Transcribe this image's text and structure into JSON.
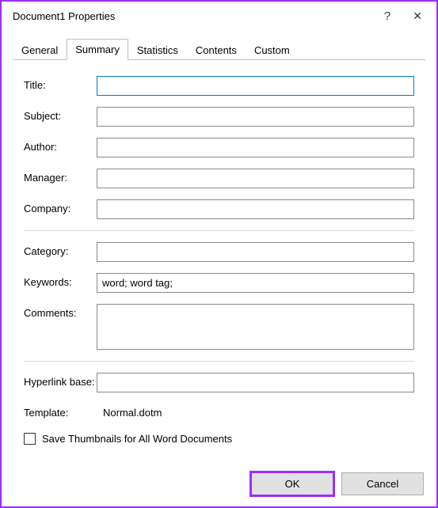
{
  "window": {
    "title": "Document1 Properties"
  },
  "tabs": {
    "general": "General",
    "summary": "Summary",
    "statistics": "Statistics",
    "contents": "Contents",
    "custom": "Custom"
  },
  "labels": {
    "title": "Title:",
    "subject": "Subject:",
    "author": "Author:",
    "manager": "Manager:",
    "company": "Company:",
    "category": "Category:",
    "keywords": "Keywords:",
    "comments": "Comments:",
    "hyperlink_base": "Hyperlink base:",
    "template": "Template:",
    "save_thumbnails": "Save Thumbnails for All Word Documents"
  },
  "values": {
    "title": "",
    "subject": "",
    "author": "",
    "manager": "",
    "company": "",
    "category": "",
    "keywords": "word; word tag;",
    "comments": "",
    "hyperlink_base": "",
    "template": "Normal.dotm"
  },
  "buttons": {
    "ok": "OK",
    "cancel": "Cancel"
  }
}
